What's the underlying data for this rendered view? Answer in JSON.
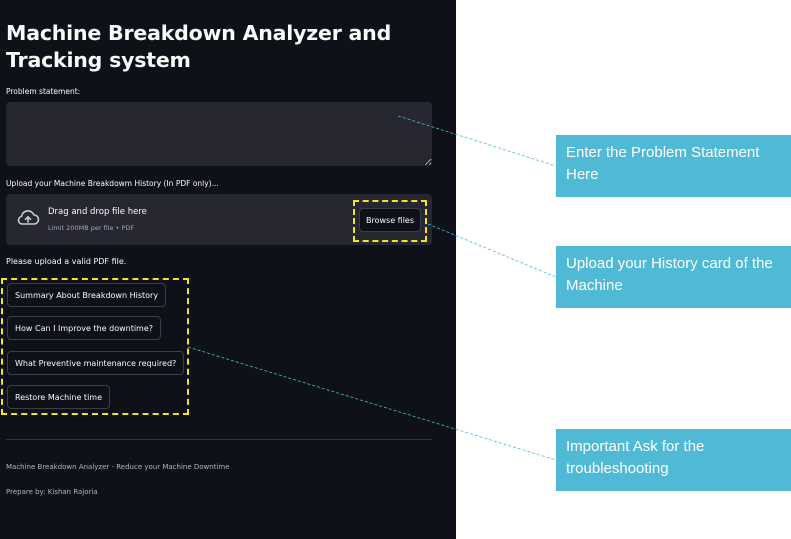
{
  "app": {
    "title": "Machine Breakdown Analyzer and Tracking system",
    "problem_label": "Problem statement:",
    "problem_value": "",
    "upload_label": "Upload your Machine Breakdowm History (In PDF only)...",
    "dropzone": {
      "icon": "upload-cloud-icon",
      "title": "Drag and drop file here",
      "subtitle": "Limit 200MB per file • PDF",
      "browse_label": "Browse files"
    },
    "error_text": "Please upload a valid PDF file.",
    "questions": [
      "Summary About Breakdown History",
      "How Can I Improve the downtime?",
      "What Preventive maintenance required?",
      "Restore Machine time"
    ],
    "footer_tagline": "Machine Breakdown Analyzer - Reduce your Machine Downtime",
    "footer_author": "Prepare by: Kishan Rajoria"
  },
  "callouts": [
    "Enter the Problem Statement Here",
    "Upload your History card of the Machine",
    "Important Ask for the troubleshooting"
  ],
  "colors": {
    "app_background": "#0e1117",
    "input_background": "#262730",
    "highlight": "#f5e51f",
    "callout": "#4fb9d6",
    "connector": "#4fb9d6"
  }
}
